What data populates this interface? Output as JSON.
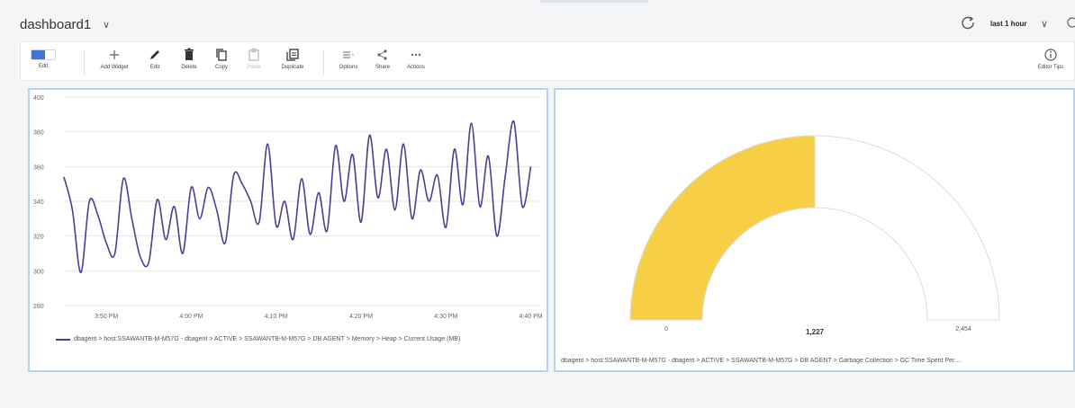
{
  "header": {
    "title": "dashboard1",
    "time_range": "last 1 hour"
  },
  "toolbar": {
    "edit_toggle_label": "Edit",
    "add_widget": "Add Widget",
    "edit": "Edit",
    "delete": "Delete",
    "copy": "Copy",
    "paste": "Paste",
    "duplicate": "Duplicate",
    "options": "Options",
    "share": "Share",
    "actions": "Actions",
    "editor_tips": "Editor Tips"
  },
  "line_widget": {
    "legend": "dbagent > host:SSAWANTB-M-M57G - dbagent > ACTIVE > SSAWANTB-M-M57G > DB AGENT > Memory > Heap > Current Usage (MB)"
  },
  "gauge_widget": {
    "caption": "dbagent > host:SSAWANTB-M-M57G - dbagent > ACTIVE > SSAWANTB-M-M57G > DB AGENT > Garbage Collection > GC Time Spent Per ..."
  },
  "chart_data": [
    {
      "type": "line",
      "title": "",
      "xlabel": "",
      "ylabel": "",
      "ylim": [
        280,
        400
      ],
      "yticks": [
        280,
        300,
        320,
        340,
        360,
        380,
        400
      ],
      "xlim": [
        0,
        56
      ],
      "x_ticks": [
        {
          "x": 5,
          "label": "3:50 PM"
        },
        {
          "x": 15,
          "label": "4:00 PM"
        },
        {
          "x": 25,
          "label": "4:10 PM"
        },
        {
          "x": 35,
          "label": "4:20 PM"
        },
        {
          "x": 45,
          "label": "4:30 PM"
        },
        {
          "x": 55,
          "label": "4:40 PM"
        }
      ],
      "grid": true,
      "legend_position": "bottom",
      "color": "#4a3f97",
      "series": [
        {
          "name": "dbagent > host:SSAWANTB-M-M57G - dbagent > ACTIVE > SSAWANTB-M-M57G > DB AGENT > Memory > Heap > Current Usage (MB)",
          "points": [
            [
              0,
              354
            ],
            [
              1,
              335
            ],
            [
              2,
              299
            ],
            [
              3,
              340
            ],
            [
              4,
              332
            ],
            [
              5,
              316
            ],
            [
              6,
              310
            ],
            [
              7,
              353
            ],
            [
              8,
              330
            ],
            [
              9,
              308
            ],
            [
              10,
              305
            ],
            [
              11,
              341
            ],
            [
              12,
              318
            ],
            [
              13,
              337
            ],
            [
              14,
              310
            ],
            [
              15,
              348
            ],
            [
              16,
              330
            ],
            [
              17,
              348
            ],
            [
              18,
              335
            ],
            [
              19,
              316
            ],
            [
              20,
              355
            ],
            [
              21,
              350
            ],
            [
              22,
              340
            ],
            [
              23,
              328
            ],
            [
              24,
              373
            ],
            [
              25,
              326
            ],
            [
              26,
              340
            ],
            [
              27,
              318
            ],
            [
              28,
              353
            ],
            [
              29,
              321
            ],
            [
              30,
              345
            ],
            [
              31,
              323
            ],
            [
              32,
              372
            ],
            [
              33,
              340
            ],
            [
              34,
              367
            ],
            [
              35,
              328
            ],
            [
              36,
              378
            ],
            [
              37,
              342
            ],
            [
              38,
              370
            ],
            [
              39,
              335
            ],
            [
              40,
              373
            ],
            [
              41,
              330
            ],
            [
              42,
              358
            ],
            [
              43,
              340
            ],
            [
              44,
              355
            ],
            [
              45,
              325
            ],
            [
              46,
              370
            ],
            [
              47,
              338
            ],
            [
              48,
              385
            ],
            [
              49,
              337
            ],
            [
              50,
              366
            ],
            [
              51,
              320
            ],
            [
              52,
              355
            ],
            [
              53,
              386
            ],
            [
              54,
              337
            ],
            [
              55,
              360
            ]
          ]
        }
      ]
    },
    {
      "type": "gauge",
      "min": 0,
      "max": 2454,
      "value": 1227,
      "min_label": "0",
      "max_label": "2,454",
      "value_label": "1,227",
      "color": "#f6cf46"
    }
  ]
}
